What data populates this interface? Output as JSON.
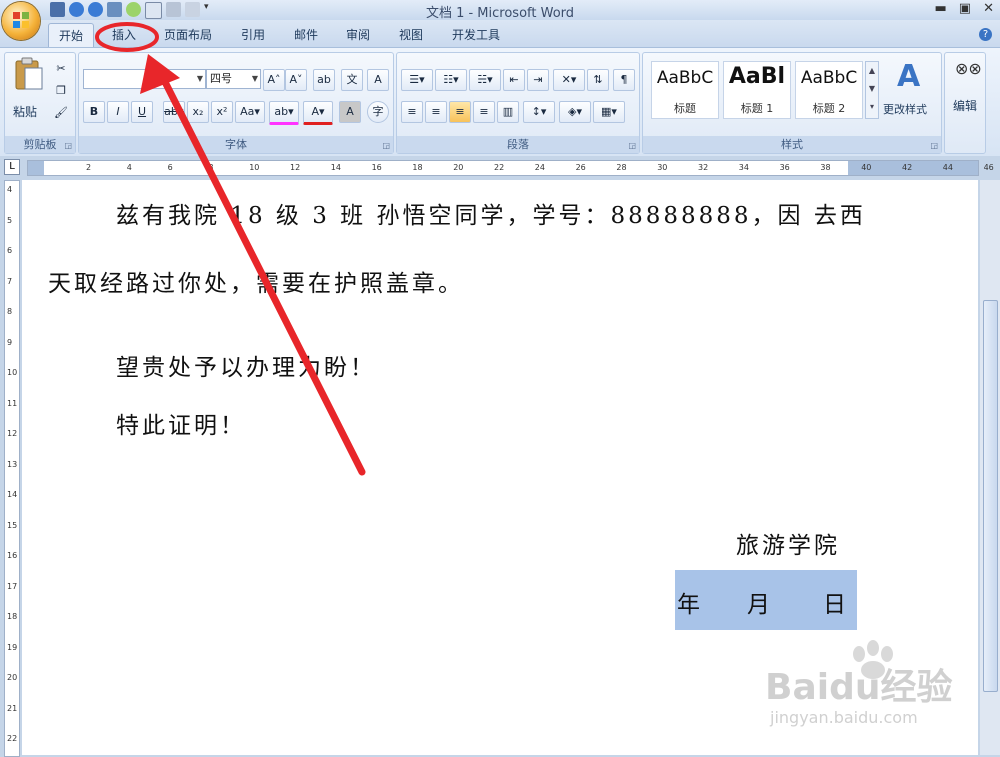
{
  "window": {
    "title": "文档 1 - Microsoft Word"
  },
  "tabs": [
    {
      "label": "开始"
    },
    {
      "label": "插入"
    },
    {
      "label": "页面布局"
    },
    {
      "label": "引用"
    },
    {
      "label": "邮件"
    },
    {
      "label": "审阅"
    },
    {
      "label": "视图"
    },
    {
      "label": "开发工具"
    }
  ],
  "ribbon": {
    "clipboard": {
      "label": "剪贴板",
      "paste": "粘贴"
    },
    "font": {
      "label": "字体",
      "size": "四号"
    },
    "paragraph": {
      "label": "段落"
    },
    "styles": {
      "label": "样式",
      "items": [
        {
          "sample": "AaBbC",
          "name": "标题"
        },
        {
          "sample": "AaBl",
          "name": "标题 1"
        },
        {
          "sample": "AaBbC",
          "name": "标题 2"
        }
      ],
      "change": "更改样式"
    },
    "editing": {
      "label": "编辑"
    }
  },
  "ruler": {
    "corner": "L",
    "h_ticks": [
      "2",
      "4",
      "6",
      "8",
      "10",
      "12",
      "14",
      "16",
      "18",
      "20",
      "22",
      "24",
      "26",
      "28",
      "30",
      "32",
      "34",
      "36",
      "38",
      "40",
      "42",
      "44",
      "46"
    ],
    "v_ticks": [
      "4",
      "5",
      "6",
      "7",
      "8",
      "9",
      "10",
      "11",
      "12",
      "13",
      "14",
      "15",
      "16",
      "17",
      "18",
      "19",
      "20",
      "21",
      "22"
    ]
  },
  "document": {
    "lines": [
      "兹有我院 18 级 3 班 孙悟空同学，学号：88888888，因 去西",
      "天取经路过你处，需要在护照盖章。",
      "望贵处予以办理为盼！",
      "特此证明！",
      "旅游学院"
    ],
    "date": {
      "year": "年",
      "month": "月",
      "day": "日"
    }
  },
  "watermark": {
    "brand": "Baidu经验",
    "url": "jingyan.baidu.com"
  },
  "annotation": {
    "color": "#e8262a"
  }
}
